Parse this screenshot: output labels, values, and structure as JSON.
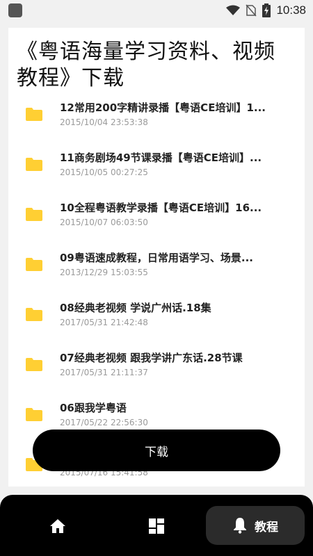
{
  "status_bar": {
    "time": "10:38",
    "icons": [
      "app-icon",
      "wifi-icon",
      "no-sim-icon",
      "battery-charging-icon"
    ]
  },
  "page": {
    "title": "《粤语海量学习资料、视频教程》下载"
  },
  "files": [
    {
      "name": "12常用200字精讲录播【粤语CE培训】1...",
      "date": "2015/10/04 23:53:38",
      "icon": "folder-icon"
    },
    {
      "name": "11商务剧场49节课录播【粤语CE培训】...",
      "date": "2015/10/05 00:27:25",
      "icon": "folder-icon"
    },
    {
      "name": "10全程粤语教学录播【粤语CE培训】16...",
      "date": "2015/10/07 06:03:50",
      "icon": "folder-icon"
    },
    {
      "name": "09粤语速成教程，日常用语学习、场景...",
      "date": "2013/12/29 15:03:55",
      "icon": "folder-icon"
    },
    {
      "name": "08经典老视频 学说广州话.18集",
      "date": "2017/05/31 21:42:48",
      "icon": "folder-icon"
    },
    {
      "name": "07经典老视频 跟我学讲广东话.28节课",
      "date": "2017/05/31 21:11:37",
      "icon": "folder-icon"
    },
    {
      "name": "06跟我学粤语",
      "date": "2017/05/22 22:56:30",
      "icon": "folder-icon"
    },
    {
      "name": "",
      "date": "2015/07/16 15:41:58",
      "icon": "folder-icon"
    }
  ],
  "download_button": {
    "label": "下载"
  },
  "bottom_nav": {
    "items": [
      {
        "icon": "home-icon",
        "label": ""
      },
      {
        "icon": "dashboard-icon",
        "label": ""
      },
      {
        "icon": "bell-icon",
        "label": "教程"
      }
    ]
  },
  "colors": {
    "folder": "#FFCF33",
    "accent": "#000000",
    "nav_active_bg": "#2B2B2B"
  }
}
